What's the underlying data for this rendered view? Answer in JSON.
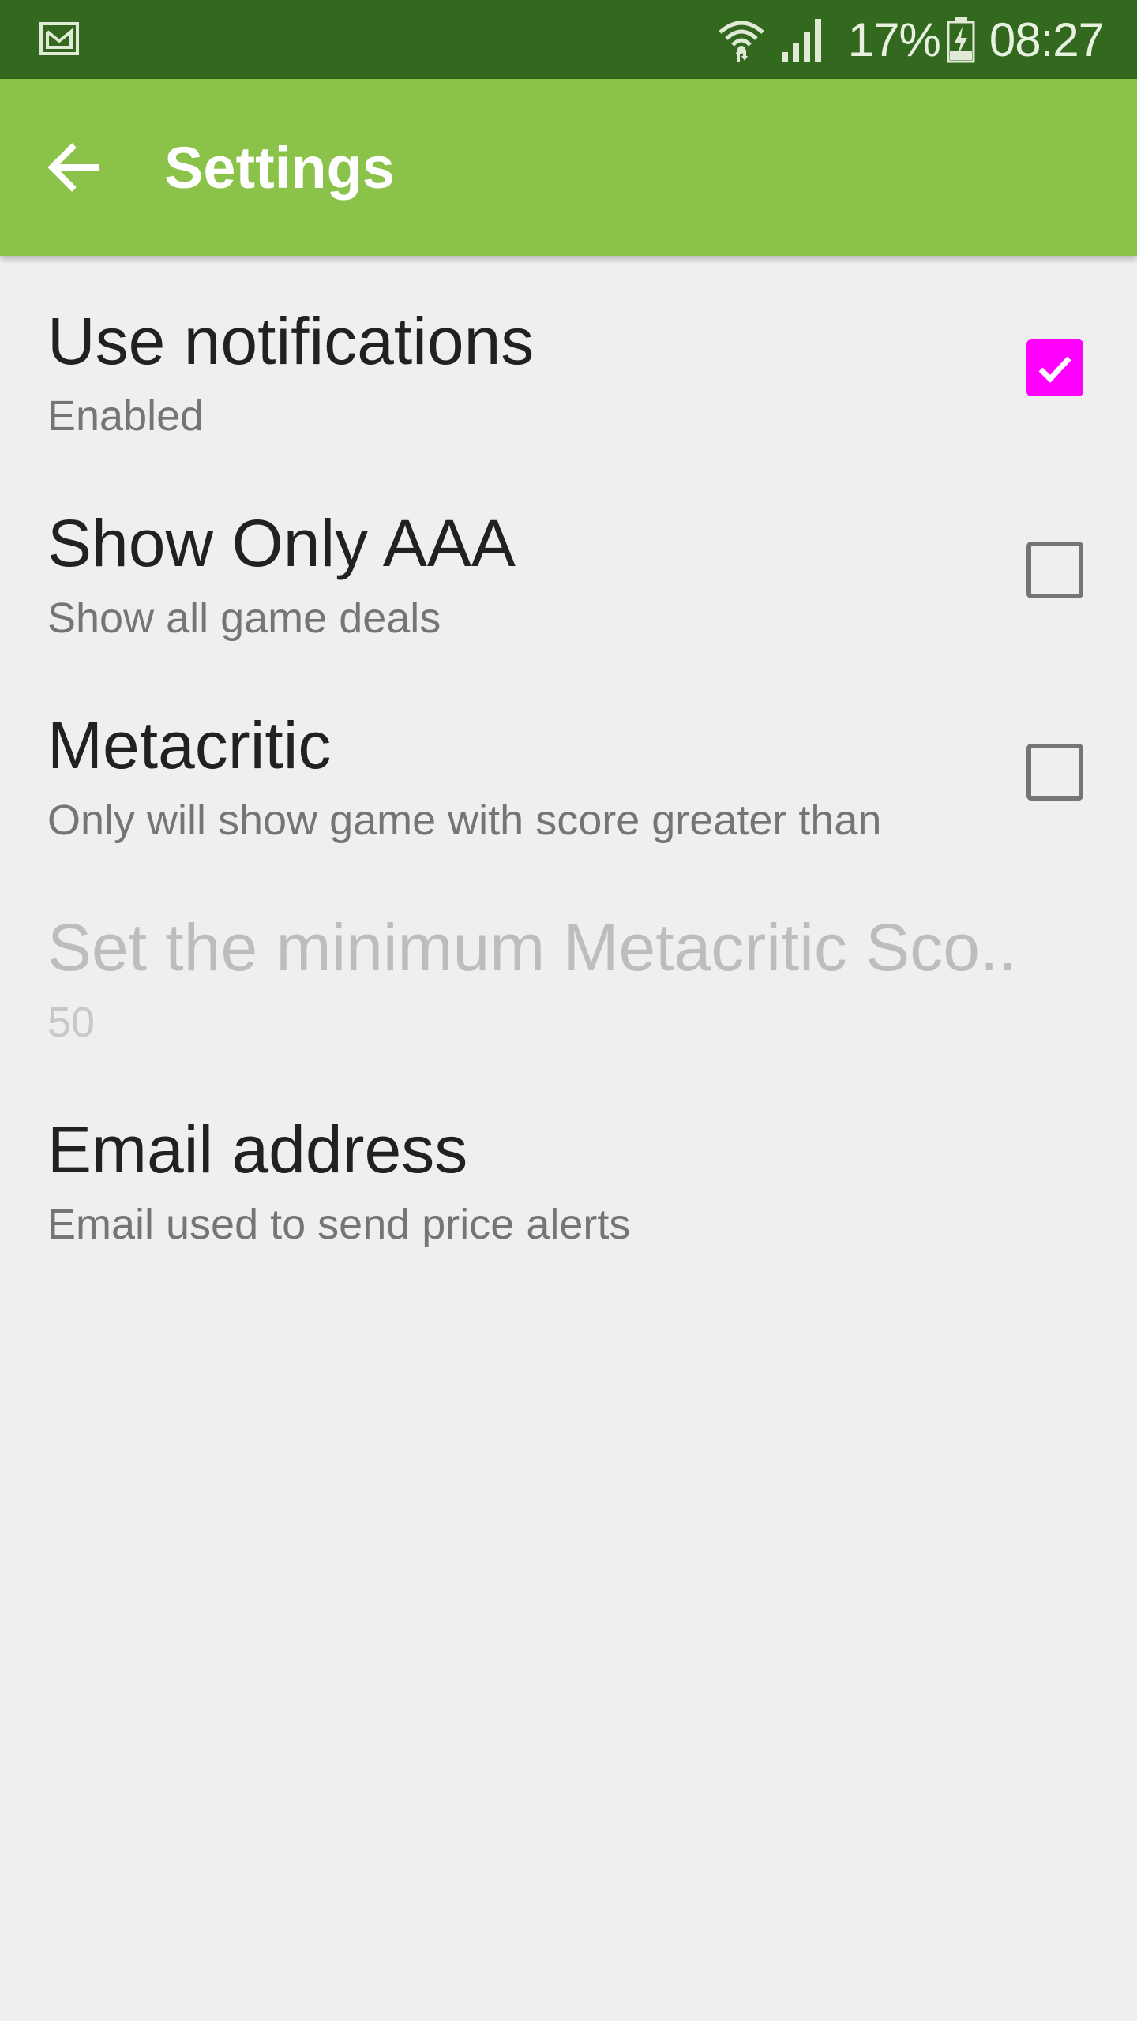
{
  "status_bar": {
    "notification_icon": "gmail-icon",
    "battery_percent": "17%",
    "time": "08:27",
    "wifi_icon": "wifi-icon",
    "signal_icon": "cell-signal-icon",
    "battery_icon": "battery-charging-icon",
    "background_color": "#33691e"
  },
  "app_bar": {
    "title": "Settings",
    "back_icon": "arrow-back-icon",
    "background_color": "#8bc34a"
  },
  "preferences": [
    {
      "title": "Use notifications",
      "summary": "Enabled",
      "checked": true,
      "has_checkbox": true,
      "enabled": true
    },
    {
      "title": "Show Only AAA",
      "summary": "Show all game deals",
      "checked": false,
      "has_checkbox": true,
      "enabled": true
    },
    {
      "title": "Metacritic",
      "summary": "Only will show game with score greater than",
      "checked": false,
      "has_checkbox": true,
      "enabled": true
    },
    {
      "title": "Set the minimum Metacritic Sco..",
      "summary": "50",
      "has_checkbox": false,
      "enabled": false
    },
    {
      "title": "Email address",
      "summary": "Email used to send price alerts",
      "has_checkbox": false,
      "enabled": true
    }
  ],
  "accent_color": "#ff00ff"
}
